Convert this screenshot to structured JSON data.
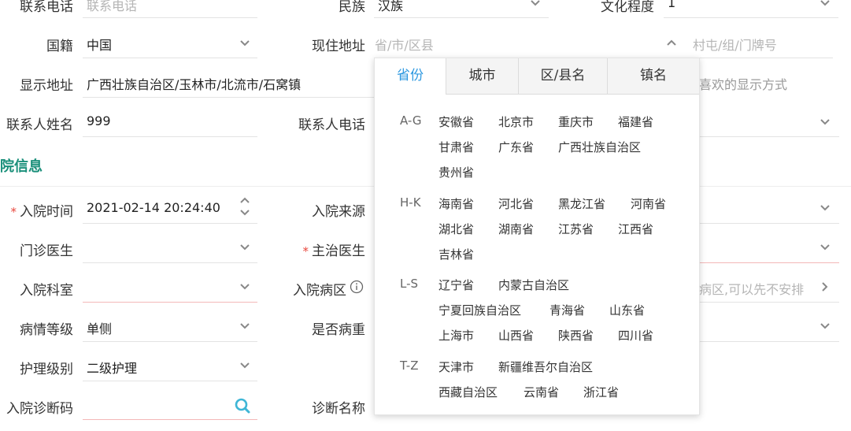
{
  "row0": {
    "contact_phone_label": "联系电话",
    "contact_phone_placeholder": "联系电话",
    "ethnicity_label": "民族",
    "ethnicity_value": "汉族",
    "education_label": "文化程度",
    "education_value": "1"
  },
  "row1": {
    "nationality_label": "国籍",
    "nationality_value": "中国",
    "address_label": "现住地址",
    "address_placeholder": "省/市/区县",
    "village_placeholder": "村屯/组/门牌号"
  },
  "row2": {
    "display_address_label": "显示地址",
    "display_address_value": "广西壮族自治区/玉林市/北流市/石窝镇",
    "display_hint": "喜欢的显示方式"
  },
  "row3": {
    "contact_name_label": "联系人姓名",
    "contact_name_value": "999",
    "contact_phone2_label": "联系人电话"
  },
  "section": {
    "title": "院信息"
  },
  "admission": {
    "time_label": "入院时间",
    "time_value": "2021-02-14 20:24:40",
    "source_label": "入院来源",
    "clinic_doctor_label": "门诊医生",
    "attending_label": "主治医生",
    "dept_label": "入院科室",
    "ward_label": "入院病区",
    "ward_placeholder": "病区,可以先不安排",
    "severity_label": "病情等级",
    "severity_value": "单侧",
    "critical_label": "是否病重",
    "nursing_label": "护理级别",
    "nursing_value": "二级护理",
    "diag_code_label": "入院诊断码",
    "diag_name_label": "诊断名称"
  },
  "cascader": {
    "tabs": [
      "省份",
      "城市",
      "区/县名",
      "镇名"
    ],
    "groups": [
      {
        "label": "A-G",
        "items": [
          "安徽省",
          "北京市",
          "重庆市",
          "福建省",
          "甘肃省",
          "广东省",
          "广西壮族自治区",
          "贵州省"
        ]
      },
      {
        "label": "H-K",
        "items": [
          "海南省",
          "河北省",
          "黑龙江省",
          "河南省",
          "湖北省",
          "湖南省",
          "江苏省",
          "江西省",
          "吉林省"
        ]
      },
      {
        "label": "L-S",
        "items": [
          "辽宁省",
          "内蒙古自治区",
          "宁夏回族自治区",
          "青海省",
          "山东省",
          "上海市",
          "山西省",
          "陕西省",
          "四川省"
        ]
      },
      {
        "label": "T-Z",
        "items": [
          "天津市",
          "新疆维吾尔自治区",
          "西藏自治区",
          "云南省",
          "浙江省"
        ]
      }
    ]
  },
  "colors": {
    "accent": "#2d98e0",
    "section": "#1a8f7a",
    "required": "#e8473d"
  }
}
